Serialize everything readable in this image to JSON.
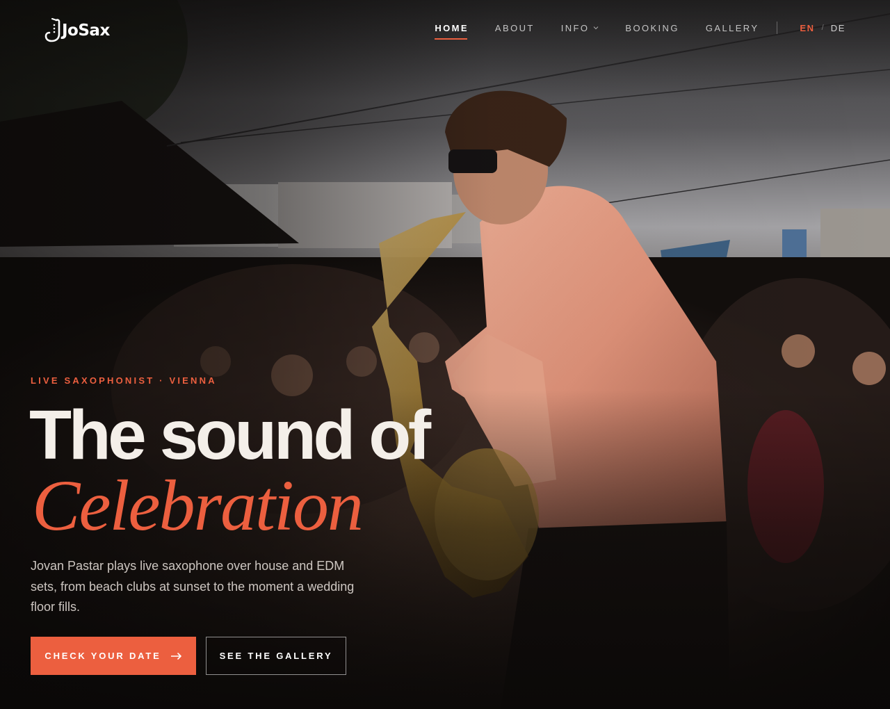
{
  "brand": {
    "logo_text": "JoSax"
  },
  "nav": {
    "items": [
      {
        "label": "HOME",
        "active": true
      },
      {
        "label": "ABOUT",
        "active": false
      },
      {
        "label": "INFO",
        "active": false,
        "has_dropdown": true
      },
      {
        "label": "BOOKING",
        "active": false
      },
      {
        "label": "GALLERY",
        "active": false
      }
    ],
    "languages": [
      {
        "code": "EN",
        "active": true
      },
      {
        "code": "DE",
        "active": false
      }
    ],
    "language_separator": "/"
  },
  "hero": {
    "eyebrow": "LIVE SAXOPHONIST · VIENNA",
    "headline_main": "The sound of",
    "headline_accent": "Celebration",
    "intro": "Jovan Pastar plays live saxophone over house and EDM sets, from beach clubs at sunset to the moment a wedding floor fills.",
    "primary_cta": {
      "label": "CHECK YOUR DATE",
      "icon": "arrow-right-icon"
    },
    "secondary_cta": {
      "label": "SEE THE GALLERY"
    }
  },
  "colors": {
    "accent": "#ec5f3f",
    "background": "#0c0a09",
    "headline": "#f4efe9",
    "text_muted": "#d9cfc8"
  }
}
